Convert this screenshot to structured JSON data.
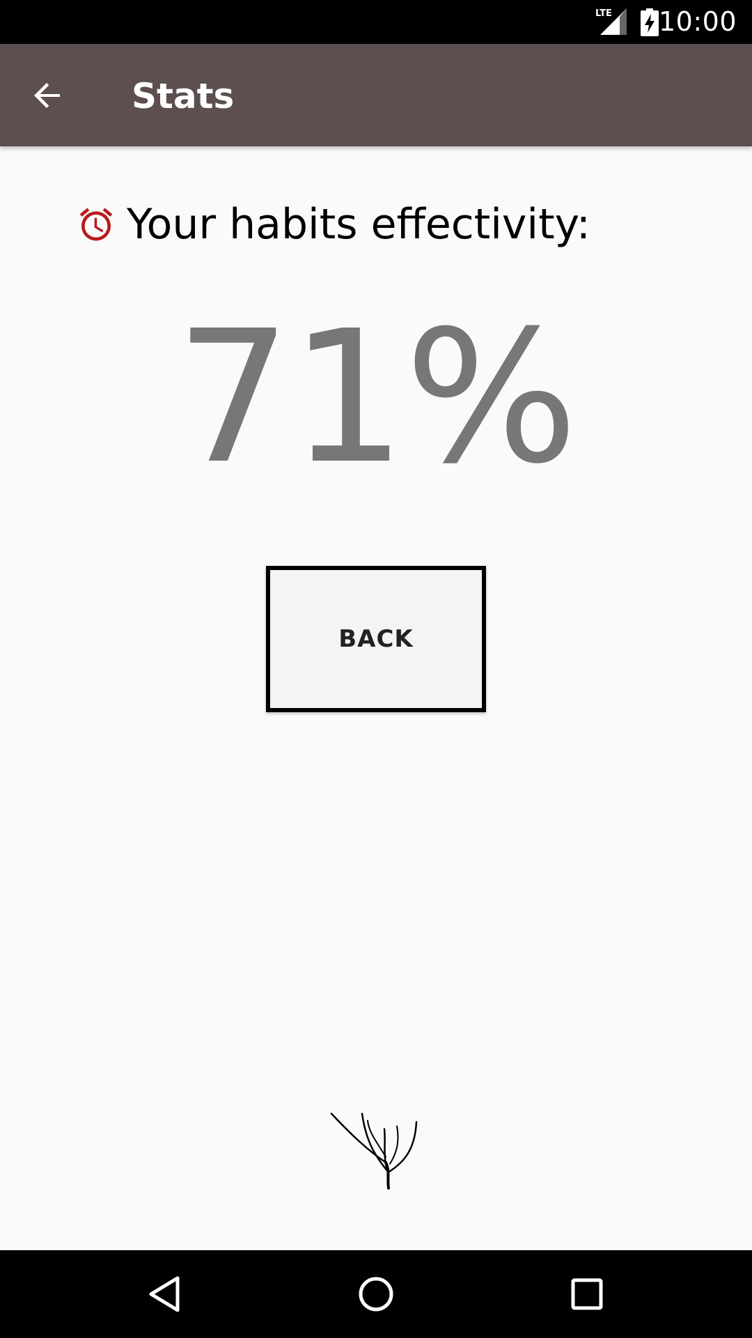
{
  "status_bar": {
    "time": "10:00",
    "network_label": "LTE",
    "icons": [
      "lte-signal-icon",
      "battery-charging-icon"
    ]
  },
  "app_bar": {
    "title": "Stats",
    "back_icon": "arrow-back-icon",
    "background_color": "#5d4f4f"
  },
  "content": {
    "heading": "Your habits effectivity:",
    "heading_icon": "alarm-clock-icon",
    "heading_icon_color": "#b71c1c",
    "effectivity_value": "71%",
    "back_button_label": "BACK"
  },
  "footer": {
    "logo_icon": "tree-branch-logo"
  },
  "nav_bar": {
    "icons": [
      "nav-back-icon",
      "nav-home-icon",
      "nav-recents-icon"
    ]
  }
}
